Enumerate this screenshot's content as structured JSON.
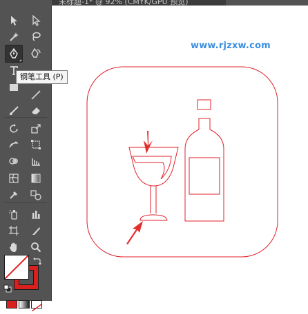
{
  "window": {
    "doc_tab_title": "未标题-1* @ 92% (CMYK/GPU 预览)"
  },
  "toolbar": {
    "tools": [
      {
        "id": "selection",
        "icon": "selection-arrow-icon"
      },
      {
        "id": "direct-selection",
        "icon": "direct-selection-arrow-icon"
      },
      {
        "id": "magic-wand",
        "icon": "magic-wand-icon"
      },
      {
        "id": "lasso",
        "icon": "lasso-icon"
      },
      {
        "id": "pen",
        "icon": "pen-icon",
        "active": true
      },
      {
        "id": "curvature",
        "icon": "curvature-pen-icon"
      },
      {
        "id": "type",
        "icon": "type-icon"
      },
      {
        "id": "rectangle",
        "icon": "rectangle-icon"
      },
      {
        "id": "paintbrush",
        "icon": "paintbrush-icon"
      },
      {
        "id": "eraser",
        "icon": "eraser-icon"
      },
      {
        "id": "rotate",
        "icon": "rotate-icon"
      },
      {
        "id": "scale",
        "icon": "scale-icon"
      },
      {
        "id": "puppet-warp",
        "icon": "puppet-warp-icon"
      },
      {
        "id": "free-transform",
        "icon": "free-transform-icon"
      },
      {
        "id": "shape-builder",
        "icon": "shape-builder-icon"
      },
      {
        "id": "graph",
        "icon": "column-graph-icon"
      },
      {
        "id": "mesh",
        "icon": "mesh-icon"
      },
      {
        "id": "gradient",
        "icon": "gradient-icon"
      },
      {
        "id": "eyedropper",
        "icon": "eyedropper-icon"
      },
      {
        "id": "blend",
        "icon": "blend-icon"
      },
      {
        "id": "symbol-sprayer",
        "icon": "symbol-sprayer-icon"
      },
      {
        "id": "bar-graph",
        "icon": "bar-graph-icon"
      },
      {
        "id": "artboard",
        "icon": "artboard-icon"
      },
      {
        "id": "slice",
        "icon": "slice-icon"
      },
      {
        "id": "hand",
        "icon": "hand-icon"
      },
      {
        "id": "zoom",
        "icon": "zoom-icon"
      }
    ],
    "fill_color": "#ffffff",
    "stroke_color": "#d8201f"
  },
  "tooltip": {
    "text": "钢笔工具 (P)"
  },
  "canvas": {
    "watermark": "www.rjzxw.com",
    "artwork_stroke": "#e0202a",
    "arrow_color": "#e03030"
  }
}
